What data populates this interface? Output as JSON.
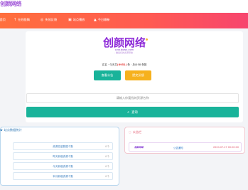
{
  "site": {
    "logo_small": "创颜网络"
  },
  "nav": [
    {
      "icon": "·",
      "label": "首页"
    },
    {
      "icon": "↑",
      "label": "在线投稿"
    },
    {
      "icon": "◎",
      "label": "失效反馈"
    },
    {
      "icon": "▣",
      "label": "站点播放"
    },
    {
      "icon": "▲",
      "label": "今日最新"
    }
  ],
  "brand": {
    "title": "创颜网络",
    "url": "cyw.buwx.com",
    "slogan": "- 做最好的资源导航 -"
  },
  "info": {
    "prefix": "实名 · 今天共",
    "highlight": "(6951)",
    "suffix": " 条 · 总计58 条数"
  },
  "buttons": {
    "notice": "查看公告",
    "feedback": "提交反馈"
  },
  "search": {
    "placeholder": "请输入你要找的资源名称",
    "button_label": "查询"
  },
  "stats": {
    "title": "站点数据统计",
    "rows": [
      {
        "label": "资源总量数据个数",
        "value": "0个"
      },
      {
        "label": "昨天新增资源个数",
        "value": "0个"
      },
      {
        "label": "今天新增资源个数",
        "value": "0个"
      },
      {
        "label": "本月新增资源个数",
        "value": "0个"
      }
    ]
  },
  "notice": {
    "title": "公告栏",
    "rows": [
      {
        "tag": "创颜网络",
        "title": "公告通知",
        "time": "2020-07-27 00:00:00"
      }
    ]
  }
}
